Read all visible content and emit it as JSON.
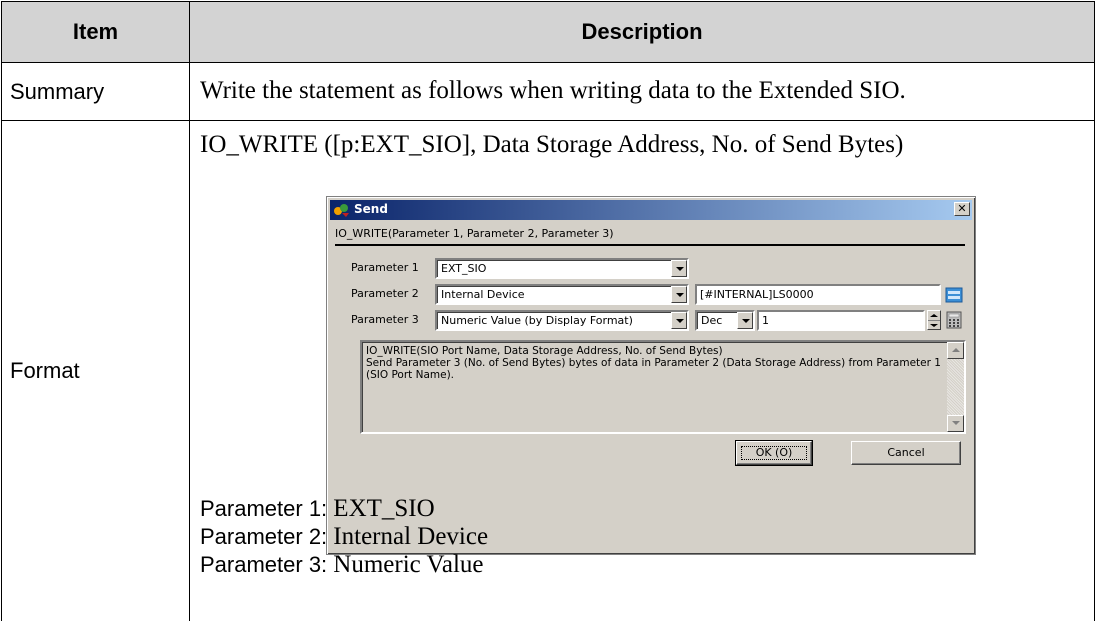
{
  "table": {
    "headers": {
      "item": "Item",
      "description": "Description"
    },
    "rows": [
      {
        "item": "Summary",
        "description": "Write the statement as follows when writing data to the Extended SIO."
      },
      {
        "item": "Format",
        "format_line": "IO_WRITE ([p:EXT_SIO], Data Storage Address, No. of Send Bytes)"
      }
    ]
  },
  "dialog": {
    "title": "Send",
    "icon": "send-app-icon",
    "close_icon": "close-icon",
    "header": "IO_WRITE(Parameter 1, Parameter 2, Parameter 3)",
    "param1": {
      "label": "Parameter 1",
      "value": "EXT_SIO"
    },
    "param2": {
      "label": "Parameter 2",
      "value": "Internal Device",
      "address": "[#INTERNAL]LS0000",
      "icon": "address-input-icon"
    },
    "param3": {
      "label": "Parameter 3",
      "value": "Numeric Value (by Display Format)",
      "format": "Dec",
      "number": "1",
      "icon": "calculator-icon"
    },
    "help_text": "IO_WRITE(SIO Port Name, Data Storage Address, No. of Send Bytes)\nSend Parameter 3 (No. of Send Bytes) bytes of data in Parameter 2 (Data Storage Address) from Parameter 1 (SIO Port Name).",
    "ok_label": "OK (O)",
    "cancel_label": "Cancel"
  },
  "param_list": [
    {
      "label": "Parameter 1:",
      "value": "EXT_SIO"
    },
    {
      "label": "Parameter 2:",
      "value": "Internal Device"
    },
    {
      "label": "Parameter 3:",
      "value": "Numeric Value"
    }
  ],
  "colors": {
    "header_bg": "#d3d3d3",
    "dialog_bg": "#d4d0c8",
    "titlebar": "#0a246a"
  }
}
